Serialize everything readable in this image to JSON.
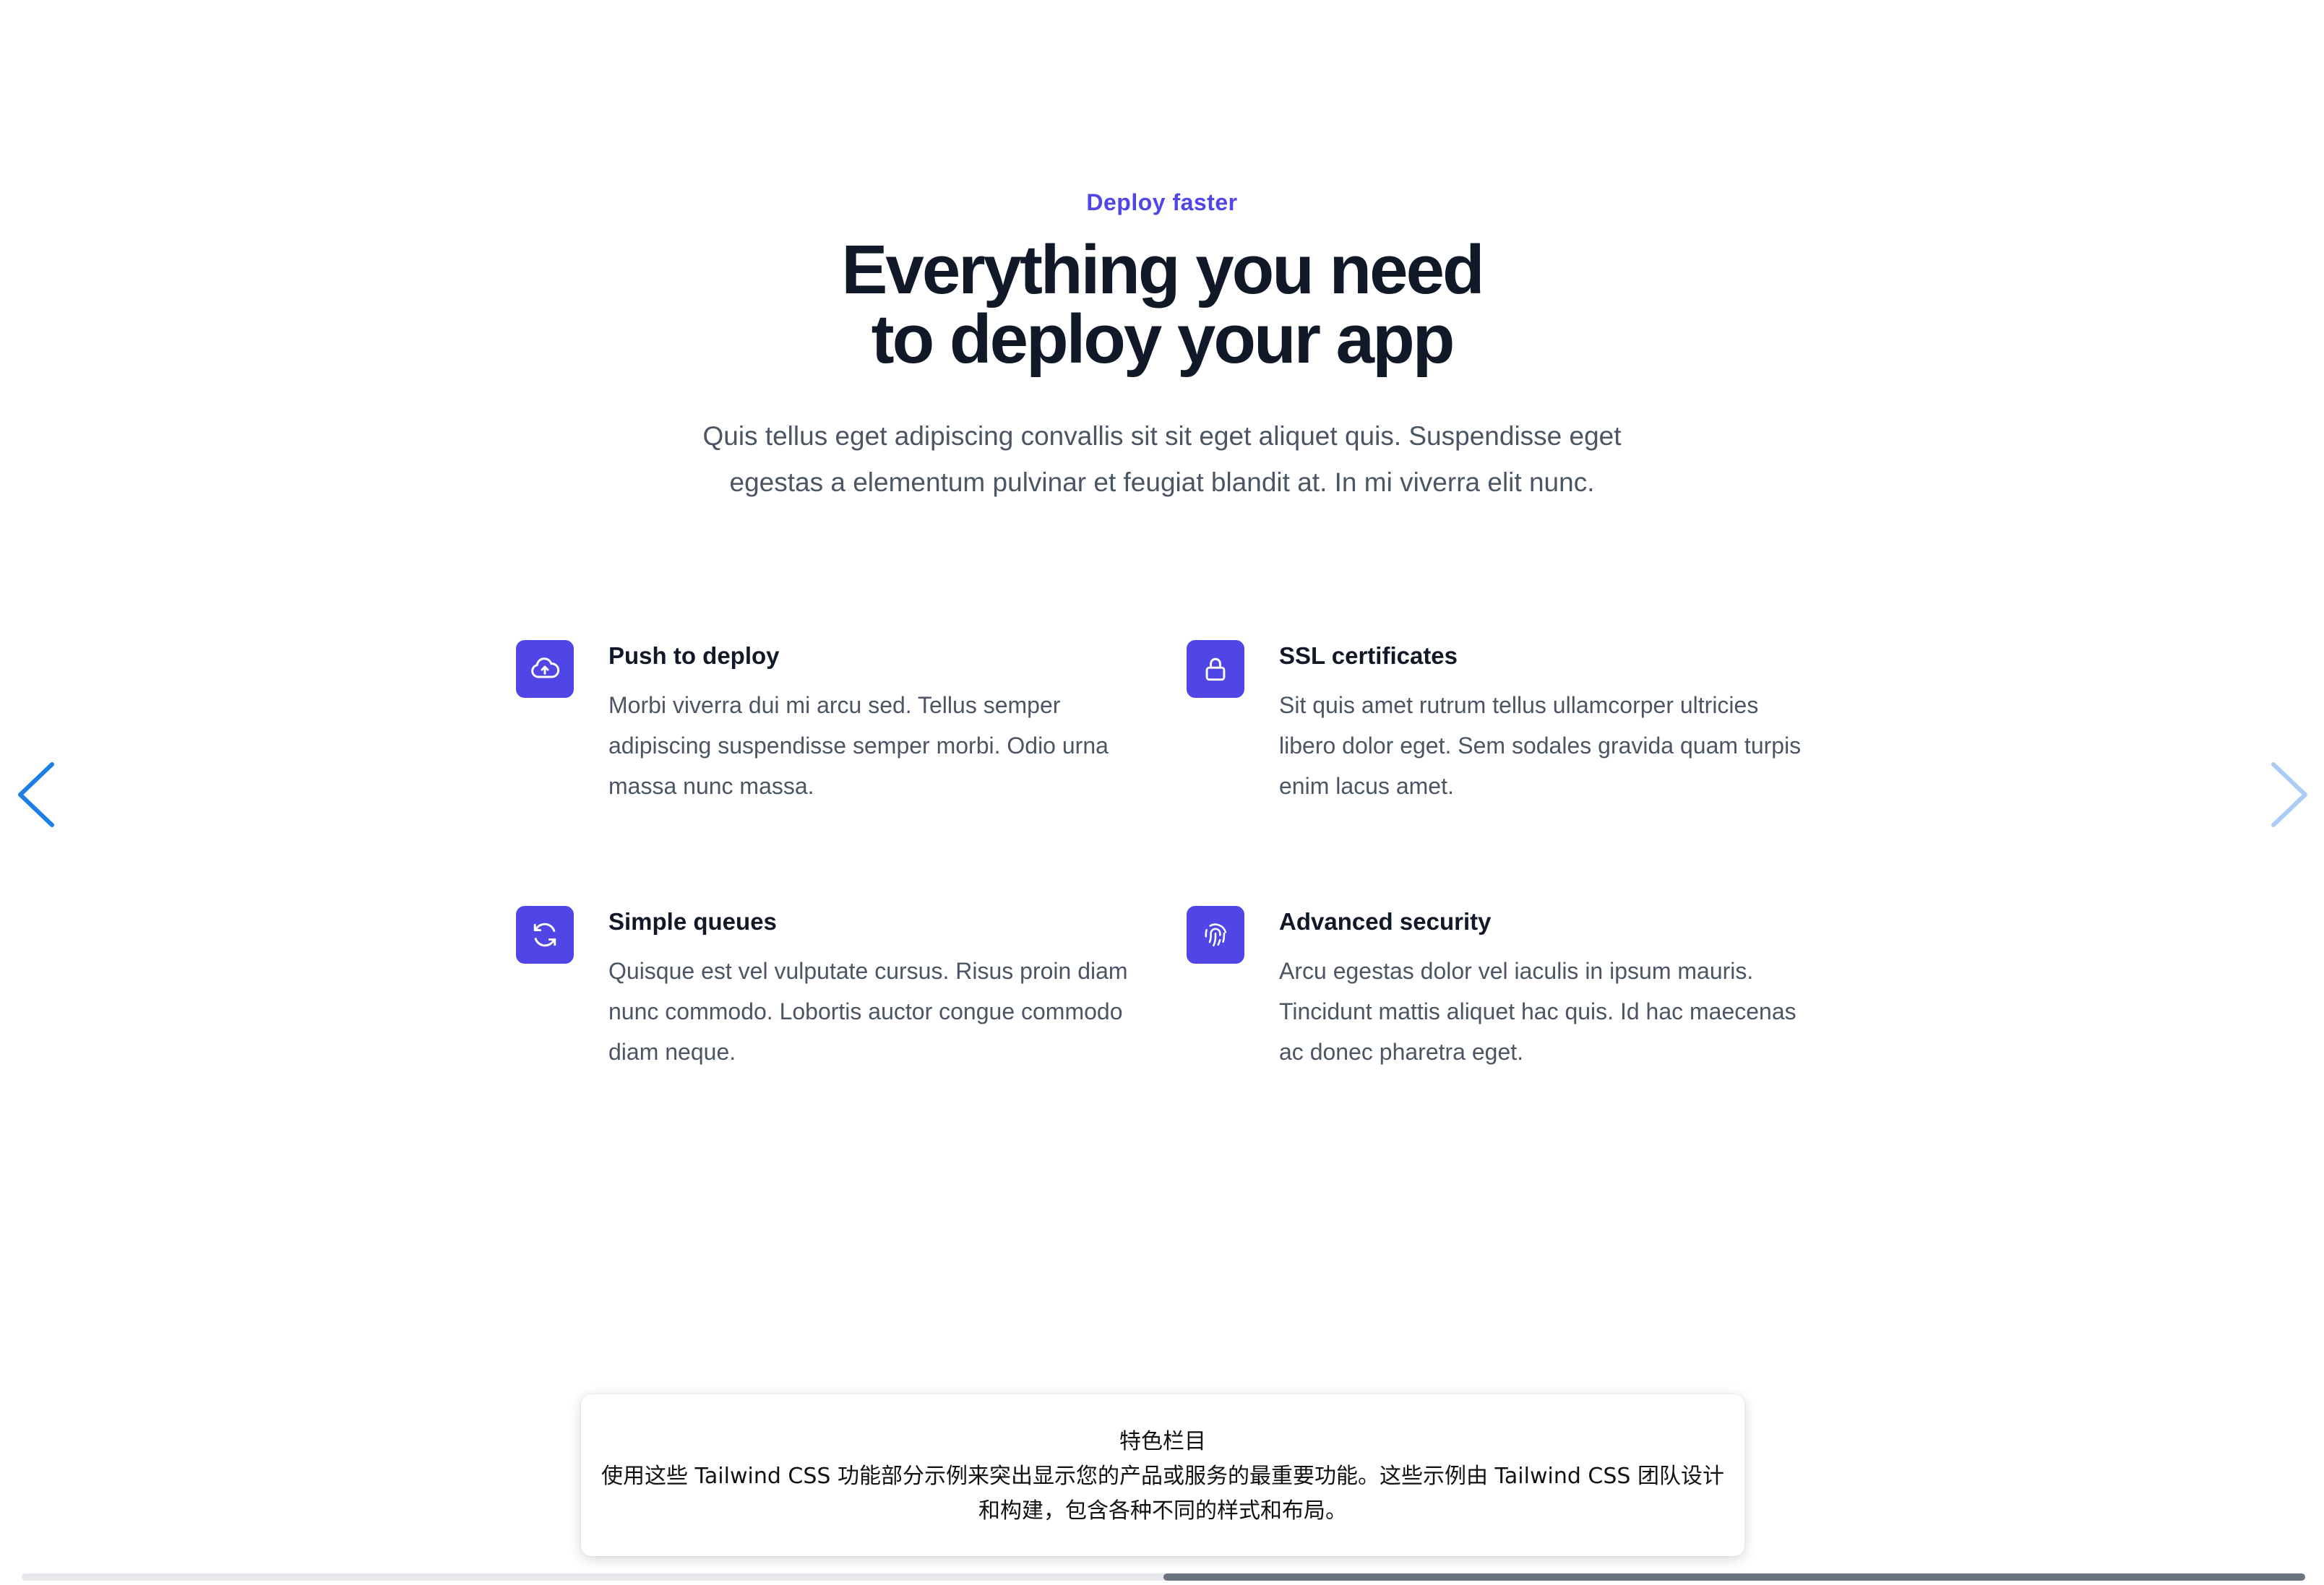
{
  "hero": {
    "eyebrow": "Deploy faster",
    "headline_line1": "Everything you need",
    "headline_line2": "to deploy your app",
    "lead_line1": "Quis tellus eget adipiscing convallis sit sit eget aliquet quis. Suspendisse eget",
    "lead_line2": "egestas a elementum pulvinar et feugiat blandit at. In mi viverra elit nunc."
  },
  "features": [
    {
      "icon": "cloud-arrow-up-icon",
      "title": "Push to deploy",
      "description": "Morbi viverra dui mi arcu sed. Tellus semper adipiscing suspendisse semper morbi. Odio urna massa nunc massa."
    },
    {
      "icon": "lock-icon",
      "title": "SSL certificates",
      "description": "Sit quis amet rutrum tellus ullamcorper ultricies libero dolor eget. Sem sodales gravida quam turpis enim lacus amet."
    },
    {
      "icon": "refresh-icon",
      "title": "Simple queues",
      "description": "Quisque est vel vulputate cursus. Risus proin diam nunc commodo. Lobortis auctor congue commodo diam neque."
    },
    {
      "icon": "fingerprint-icon",
      "title": "Advanced security",
      "description": "Arcu egestas dolor vel iaculis in ipsum mauris. Tincidunt mattis aliquet hac quis. Id hac maecenas ac donec pharetra eget."
    }
  ],
  "carousel": {
    "prev_icon": "chevron-left-icon",
    "next_icon": "chevron-right-icon"
  },
  "caption": {
    "title": "特色栏目",
    "body": "使用这些 Tailwind CSS 功能部分示例来突出显示您的产品或服务的最重要功能。这些示例由 Tailwind CSS 团队设计和构建，包含各种不同的样式和布局。"
  },
  "scroll": {
    "position": 0.5
  },
  "colors": {
    "accent": "#4f46e5",
    "heading": "#111827",
    "body": "#4b5563",
    "arrow_active": "#1d7fe6",
    "arrow_inactive": "#a9cdf5"
  }
}
